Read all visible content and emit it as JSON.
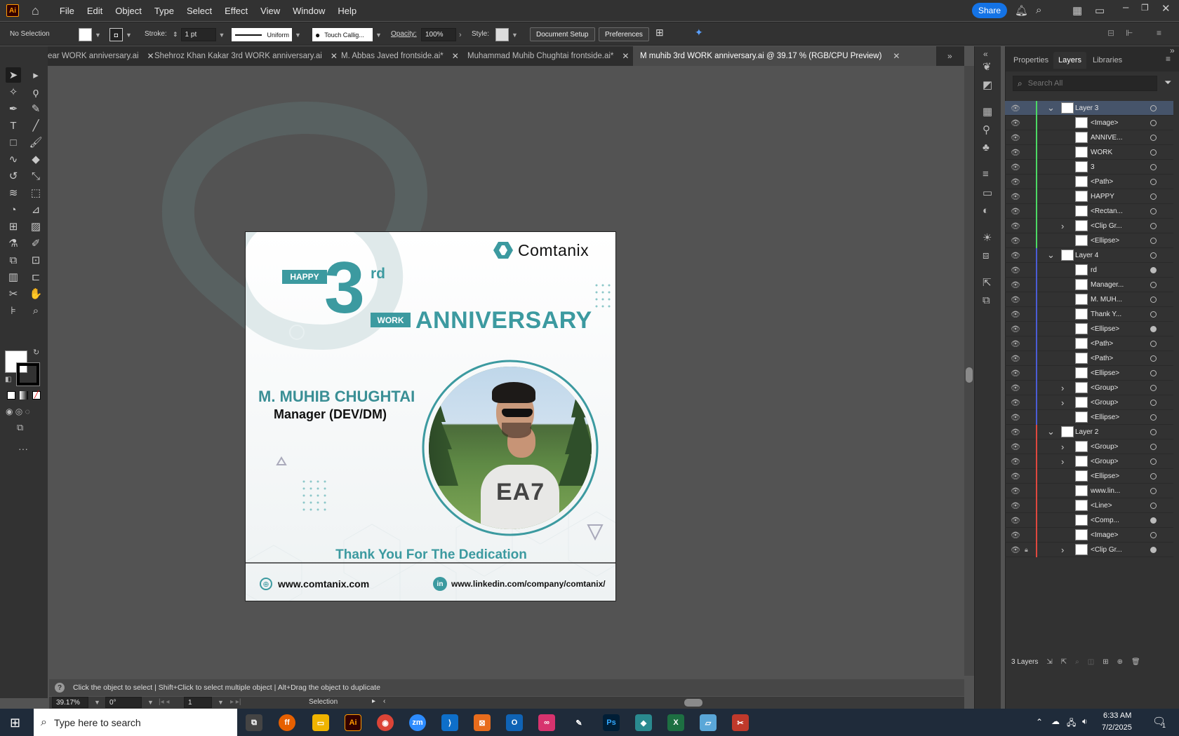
{
  "menubar": {
    "app_icon": "Ai",
    "items": [
      "File",
      "Edit",
      "Object",
      "Type",
      "Select",
      "Effect",
      "View",
      "Window",
      "Help"
    ],
    "share_label": "Share"
  },
  "control": {
    "selection_label": "No Selection",
    "stroke_label": "Stroke:",
    "stroke_weight": "1 pt",
    "stroke_profile": "Uniform",
    "brush": "Touch Callig...",
    "opacity_label": "Opacity:",
    "opacity_value": "100%",
    "style_label": "Style:",
    "doc_setup": "Document Setup",
    "preferences": "Preferences"
  },
  "tabs": [
    {
      "label": "ear WORK anniversary.ai"
    },
    {
      "label": "Shehroz Khan Kakar   3rd  WORK anniversary.ai"
    },
    {
      "label": "M. Abbas Javed   frontside.ai*"
    },
    {
      "label": "Muhammad Muhib Chughtai   frontside.ai*"
    },
    {
      "label": "M muhib 3rd  WORK anniversary.ai @ 39.17 % (RGB/CPU Preview)"
    }
  ],
  "artboard": {
    "brand": "Comtanix",
    "happy": "HAPPY",
    "number": "3",
    "suffix": "rd",
    "work": "WORK",
    "anniversary": "ANNIVERSARY",
    "name": "M. MUHIB CHUGHTAI",
    "role": "Manager (DEV/DM)",
    "thanks": "Thank You For The Dedication",
    "website": "www.comtanix.com",
    "linkedin": "www.linkedin.com/company/comtanix/",
    "shirt_text": "EA7"
  },
  "status": {
    "hint": "Click the object to select  |  Shift+Click to select multiple object  |  Alt+Drag the object to duplicate",
    "zoom": "39.17%",
    "rotation": "0°",
    "artboard_num": "1",
    "tool": "Selection"
  },
  "panel": {
    "tabs": [
      "Properties",
      "Layers",
      "Libraries"
    ],
    "search_placeholder": "Search All",
    "layer_count": "3 Layers",
    "rows": [
      {
        "name": "Layer 3",
        "color": "#4cd964",
        "level": 0,
        "expand": "v",
        "circ": "o"
      },
      {
        "name": "<Image>",
        "color": "#4cd964",
        "level": 1,
        "circ": "o"
      },
      {
        "name": "ANNIVE...",
        "color": "#4cd964",
        "level": 1,
        "circ": "o"
      },
      {
        "name": "WORK",
        "color": "#4cd964",
        "level": 1,
        "circ": "o"
      },
      {
        "name": "3",
        "color": "#4cd964",
        "level": 1,
        "circ": "o"
      },
      {
        "name": "<Path>",
        "color": "#4cd964",
        "level": 1,
        "circ": "o"
      },
      {
        "name": "HAPPY",
        "color": "#4cd964",
        "level": 1,
        "circ": "o"
      },
      {
        "name": "<Rectan...",
        "color": "#4cd964",
        "level": 1,
        "circ": "o"
      },
      {
        "name": "<Clip Gr...",
        "color": "#4cd964",
        "level": 1,
        "expand": ">",
        "circ": "o"
      },
      {
        "name": "<Ellipse>",
        "color": "#4cd964",
        "level": 1,
        "circ": "o"
      },
      {
        "name": "Layer 4",
        "color": "#4a5cd6",
        "level": 0,
        "expand": "v",
        "circ": "o"
      },
      {
        "name": "rd",
        "color": "#4a5cd6",
        "level": 1,
        "circ": "f"
      },
      {
        "name": "Manager...",
        "color": "#4a5cd6",
        "level": 1,
        "circ": "o"
      },
      {
        "name": "M. MUH...",
        "color": "#4a5cd6",
        "level": 1,
        "circ": "o"
      },
      {
        "name": "Thank Y...",
        "color": "#4a5cd6",
        "level": 1,
        "circ": "o"
      },
      {
        "name": "<Ellipse>",
        "color": "#4a5cd6",
        "level": 1,
        "circ": "f"
      },
      {
        "name": "<Path>",
        "color": "#4a5cd6",
        "level": 1,
        "circ": "o"
      },
      {
        "name": "<Path>",
        "color": "#4a5cd6",
        "level": 1,
        "circ": "o"
      },
      {
        "name": "<Ellipse>",
        "color": "#4a5cd6",
        "level": 1,
        "circ": "o"
      },
      {
        "name": "<Group>",
        "color": "#4a5cd6",
        "level": 1,
        "expand": ">",
        "circ": "o"
      },
      {
        "name": "<Group>",
        "color": "#4a5cd6",
        "level": 1,
        "expand": ">",
        "circ": "o"
      },
      {
        "name": "<Ellipse>",
        "color": "#4a5cd6",
        "level": 1,
        "circ": "o"
      },
      {
        "name": "Layer 2",
        "color": "#e0483e",
        "level": 0,
        "expand": "v",
        "circ": "o"
      },
      {
        "name": "<Group>",
        "color": "#e0483e",
        "level": 1,
        "expand": ">",
        "circ": "o"
      },
      {
        "name": "<Group>",
        "color": "#e0483e",
        "level": 1,
        "expand": ">",
        "circ": "o"
      },
      {
        "name": "<Ellipse>",
        "color": "#e0483e",
        "level": 1,
        "circ": "o"
      },
      {
        "name": "www.lin...",
        "color": "#e0483e",
        "level": 1,
        "circ": "o"
      },
      {
        "name": "<Line>",
        "color": "#e0483e",
        "level": 1,
        "circ": "o"
      },
      {
        "name": "<Comp...",
        "color": "#e0483e",
        "level": 1,
        "circ": "f"
      },
      {
        "name": "<Image>",
        "color": "#e0483e",
        "level": 1,
        "circ": "o"
      },
      {
        "name": "<Clip Gr...",
        "color": "#e0483e",
        "level": 1,
        "expand": ">",
        "circ": "f",
        "lock": "lock-icon"
      }
    ]
  },
  "taskbar": {
    "search_placeholder": "Type here to search",
    "time": "6:33 AM",
    "date": "7/2/2025",
    "notif": "1"
  }
}
